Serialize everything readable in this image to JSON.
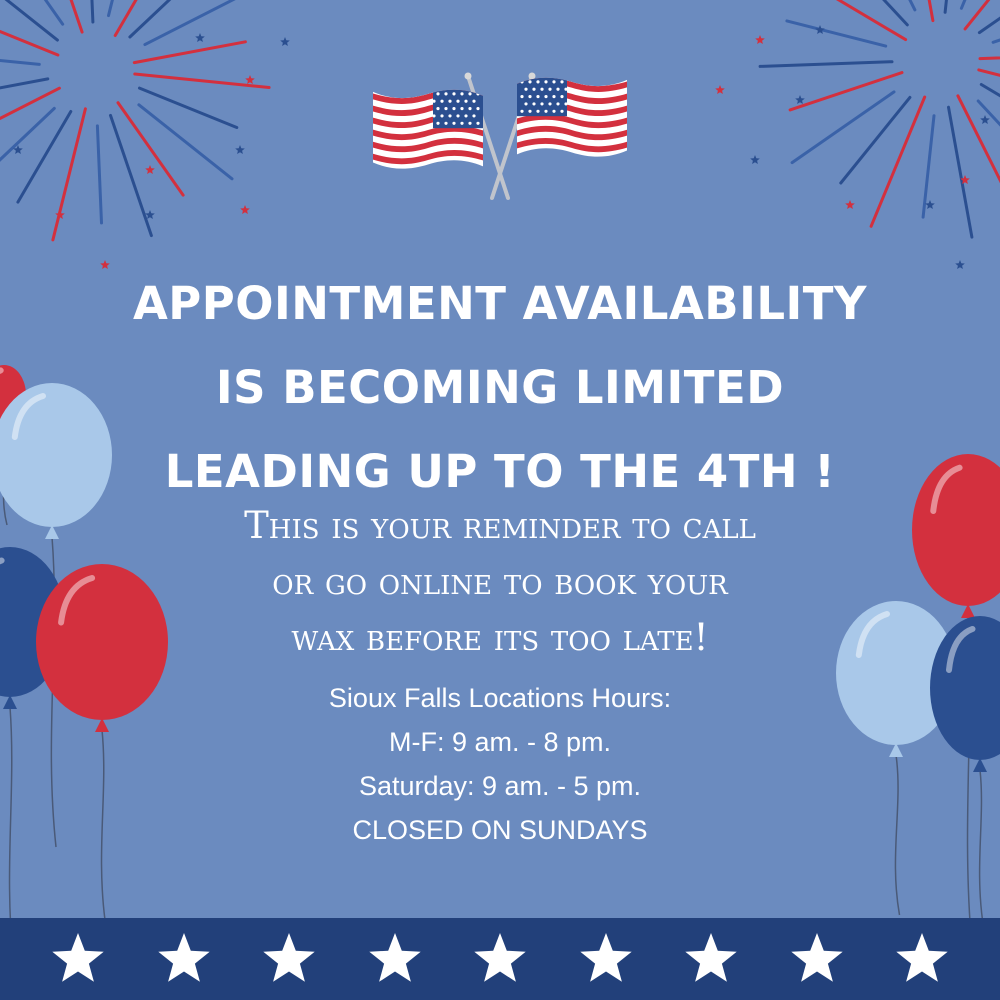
{
  "headline": {
    "lines": [
      "APPOINTMENT AVAILABILITY",
      "IS BECOMING LIMITED",
      "LEADING UP TO THE 4TH !"
    ]
  },
  "reminder": {
    "lines": [
      "This is your reminder to call",
      "or go online to book your",
      "wax before its too late!"
    ]
  },
  "hours": {
    "title": "Sioux Falls Locations Hours:",
    "weekday": "M-F: 9 am. - 8 pm.",
    "saturday": "Saturday: 9 am. - 5 pm.",
    "sunday": "CLOSED ON SUNDAYS"
  },
  "icons": {
    "flags": "crossed-american-flags-icon",
    "fireworks": "firework-burst-icon",
    "balloons": "balloon-icon",
    "stars": "star-icon"
  },
  "colors": {
    "background": "#6b8bbf",
    "red": "#d3303e",
    "navy": "#2b4f90",
    "light_blue": "#a9c8e9",
    "footer": "#22407a",
    "white": "#ffffff"
  }
}
